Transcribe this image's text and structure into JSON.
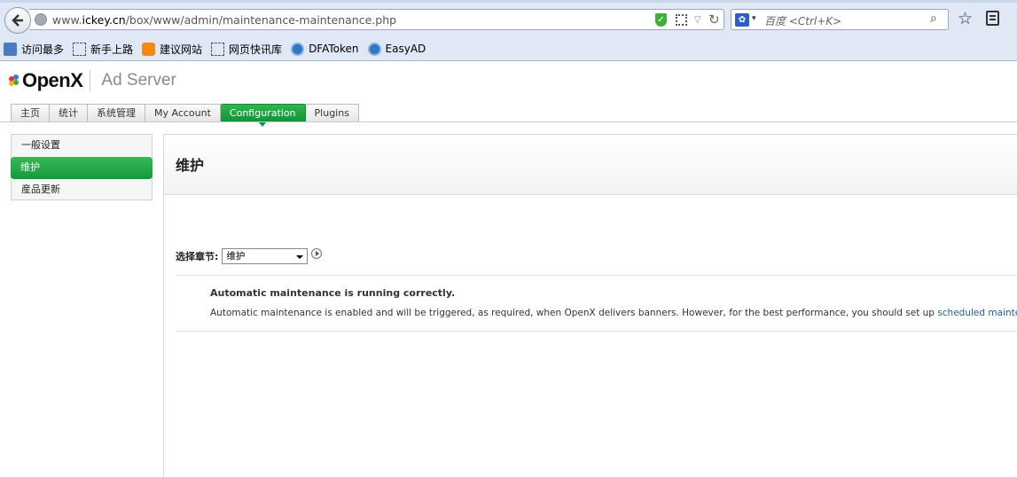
{
  "browser": {
    "url_prefix": "www.",
    "url_domain": "ickey.cn",
    "url_path": "/box/www/admin/maintenance-maintenance.php",
    "search_placeholder": "百度 <Ctrl+K>",
    "bookmarks": [
      {
        "label": "访问最多",
        "icon": "bookmark-book-icon"
      },
      {
        "label": "新手上路",
        "icon": "dashed-page-icon"
      },
      {
        "label": "建议网站",
        "icon": "bulb-icon"
      },
      {
        "label": "网页快讯库",
        "icon": "dashed-page-icon"
      },
      {
        "label": "DFAToken",
        "icon": "cloud-icon"
      },
      {
        "label": "EasyAD",
        "icon": "cloud-icon"
      }
    ]
  },
  "app": {
    "logo": "OpenX",
    "product": "Ad Server",
    "brand_green": "#13983c",
    "tabs": [
      {
        "label": "主页",
        "active": false
      },
      {
        "label": "统计",
        "active": false
      },
      {
        "label": "系统管理",
        "active": false
      },
      {
        "label": "My Account",
        "active": false
      },
      {
        "label": "Configuration",
        "active": true
      },
      {
        "label": "Plugins",
        "active": false
      }
    ]
  },
  "sidebar": {
    "items": [
      {
        "label": "一般设置",
        "active": false
      },
      {
        "label": "维护",
        "active": true
      },
      {
        "label": "産品更新",
        "active": false
      }
    ]
  },
  "main": {
    "title": "维护",
    "section_label": "选择章节:",
    "section_value": "维护",
    "message_title": "Automatic maintenance is running correctly.",
    "message_body": "Automatic maintenance is enabled and will be triggered, as required, when OpenX delivers banners. However, for the best performance, you should set up ",
    "message_link": "scheduled maintenance",
    "message_end": "."
  }
}
